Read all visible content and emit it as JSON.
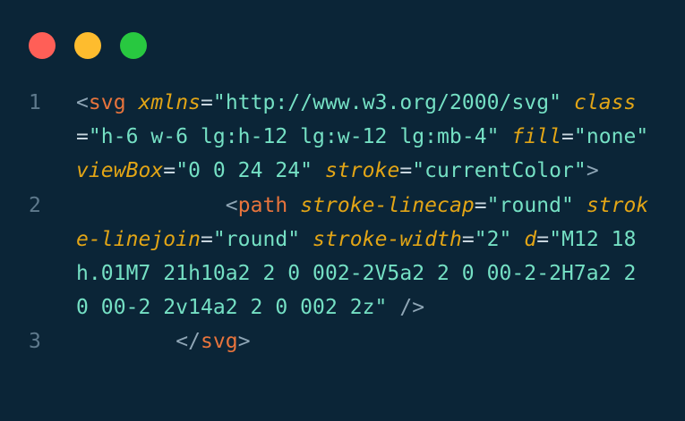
{
  "window": {
    "controls": [
      {
        "name": "close",
        "color": "#ff5f57"
      },
      {
        "name": "minimize",
        "color": "#febc2e"
      },
      {
        "name": "maximize",
        "color": "#28c840"
      }
    ]
  },
  "code": {
    "lines": [
      {
        "number": "1",
        "tokens": [
          {
            "t": "punct",
            "v": "<"
          },
          {
            "t": "tag",
            "v": "svg"
          },
          {
            "t": "ws",
            "v": " "
          },
          {
            "t": "attr",
            "v": "xmlns"
          },
          {
            "t": "eq",
            "v": "="
          },
          {
            "t": "val",
            "v": "\"http://www.w3.org/2000/svg\""
          },
          {
            "t": "ws",
            "v": " "
          },
          {
            "t": "attr",
            "v": "class"
          },
          {
            "t": "eq",
            "v": "="
          },
          {
            "t": "val",
            "v": "\"h-6 w-6 lg:h-12 lg:w-12 lg:mb-4\""
          },
          {
            "t": "ws",
            "v": " "
          },
          {
            "t": "attr",
            "v": "fill"
          },
          {
            "t": "eq",
            "v": "="
          },
          {
            "t": "val",
            "v": "\"none\""
          },
          {
            "t": "ws",
            "v": " "
          },
          {
            "t": "attr",
            "v": "viewBox"
          },
          {
            "t": "eq",
            "v": "="
          },
          {
            "t": "val",
            "v": "\"0 0 24 24\""
          },
          {
            "t": "ws",
            "v": " "
          },
          {
            "t": "attr",
            "v": "stroke"
          },
          {
            "t": "eq",
            "v": "="
          },
          {
            "t": "val",
            "v": "\"currentColor\""
          },
          {
            "t": "punct",
            "v": ">"
          }
        ]
      },
      {
        "number": "2",
        "tokens": [
          {
            "t": "ws",
            "v": "            "
          },
          {
            "t": "punct",
            "v": "<"
          },
          {
            "t": "tag",
            "v": "path"
          },
          {
            "t": "ws",
            "v": " "
          },
          {
            "t": "attr",
            "v": "stroke-linecap"
          },
          {
            "t": "eq",
            "v": "="
          },
          {
            "t": "val",
            "v": "\"round\""
          },
          {
            "t": "ws",
            "v": " "
          },
          {
            "t": "attr",
            "v": "stroke-linejoin"
          },
          {
            "t": "eq",
            "v": "="
          },
          {
            "t": "val",
            "v": "\"round\""
          },
          {
            "t": "ws",
            "v": " "
          },
          {
            "t": "attr",
            "v": "stroke-width"
          },
          {
            "t": "eq",
            "v": "="
          },
          {
            "t": "val",
            "v": "\"2\""
          },
          {
            "t": "ws",
            "v": " "
          },
          {
            "t": "attr",
            "v": "d"
          },
          {
            "t": "eq",
            "v": "="
          },
          {
            "t": "val",
            "v": "\"M12 18h.01M7 21h10a2 2 0 002-2V5a2 2 0 00-2-2H7a2 2 0 00-2 2v14a2 2 0 002 2z\""
          },
          {
            "t": "ws",
            "v": " "
          },
          {
            "t": "punct",
            "v": "/>"
          }
        ]
      },
      {
        "number": "3",
        "tokens": [
          {
            "t": "ws",
            "v": "        "
          },
          {
            "t": "punct",
            "v": "</"
          },
          {
            "t": "tag",
            "v": "svg"
          },
          {
            "t": "punct",
            "v": ">"
          }
        ]
      }
    ]
  }
}
